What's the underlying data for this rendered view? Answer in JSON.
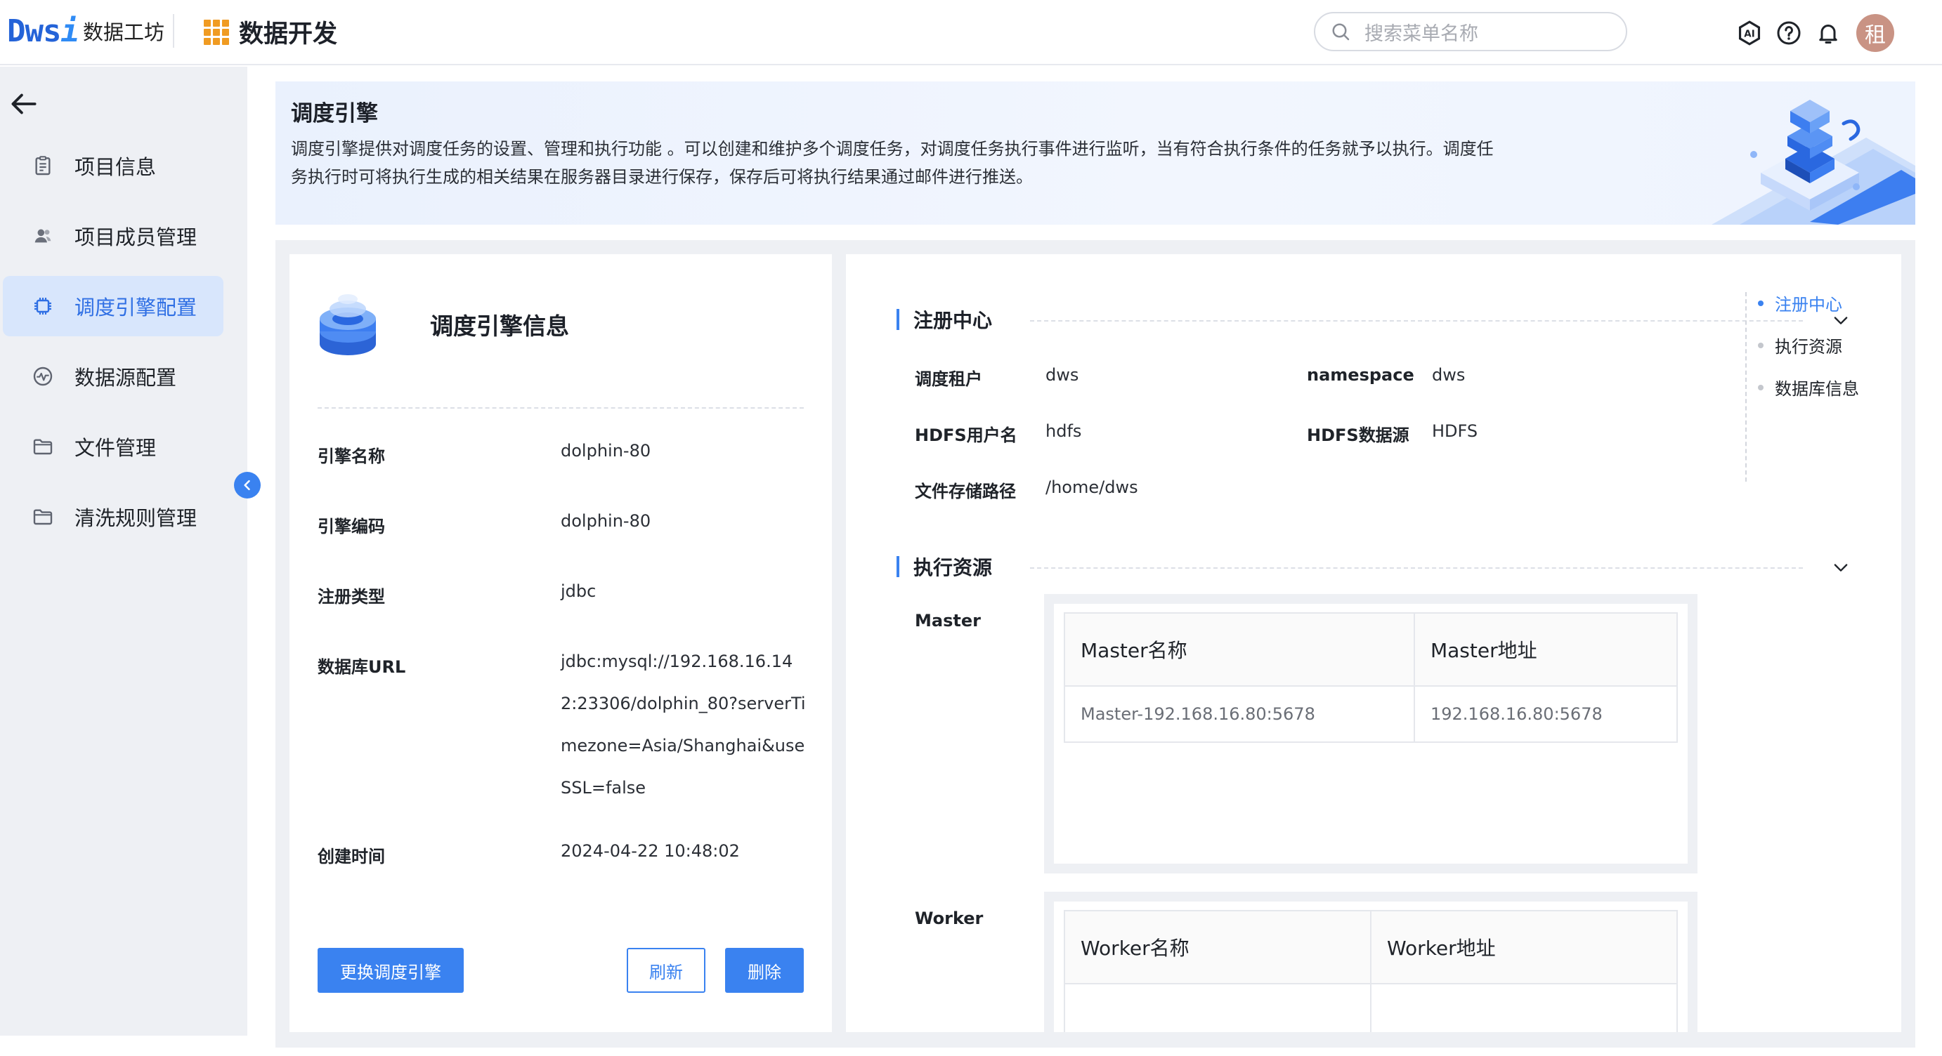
{
  "header": {
    "logo_mark": "Dws",
    "logo_mark_i": "i",
    "logo_text": "数据工坊",
    "app_title": "数据开发",
    "search_placeholder": "搜索菜单名称",
    "avatar_text": "租",
    "accent_color": "#3a82f0",
    "icons": [
      "ai-icon",
      "help-icon",
      "bell-icon"
    ]
  },
  "sidebar": {
    "items": [
      {
        "label": "项目信息",
        "icon": "clipboard-icon",
        "active": false
      },
      {
        "label": "项目成员管理",
        "icon": "users-icon",
        "active": false
      },
      {
        "label": "调度引擎配置",
        "icon": "chip-icon",
        "active": true
      },
      {
        "label": "数据源配置",
        "icon": "pulse-icon",
        "active": false
      },
      {
        "label": "文件管理",
        "icon": "folder-icon",
        "active": false
      },
      {
        "label": "清洗规则管理",
        "icon": "folder-icon",
        "active": false
      }
    ]
  },
  "banner": {
    "title": "调度引擎",
    "description": "调度引擎提供对调度任务的设置、管理和执行功能 。可以创建和维护多个调度任务，对调度任务执行事件进行监听，当有符合执行条件的任务就予以执行。调度任务执行时可将执行生成的相关结果在服务器目录进行保存，保存后可将执行结果通过邮件进行推送。"
  },
  "engine_info": {
    "title": "调度引擎信息",
    "fields": [
      {
        "label": "引擎名称",
        "value": "dolphin-80"
      },
      {
        "label": "引擎编码",
        "value": "dolphin-80"
      },
      {
        "label": "注册类型",
        "value": "jdbc"
      },
      {
        "label": "数据库URL",
        "value": "jdbc:mysql://192.168.16.142:23306/dolphin_80?serverTimezone=Asia/Shanghai&useSSL=false"
      },
      {
        "label": "创建时间",
        "value": "2024-04-22 10:48:02"
      }
    ],
    "buttons": {
      "replace": "更换调度引擎",
      "refresh": "刷新",
      "delete": "删除"
    }
  },
  "registry": {
    "title": "注册中心",
    "tenant_label": "调度租户",
    "tenant_value": "dws",
    "namespace_label": "namespace",
    "namespace_value": "dws",
    "hdfs_user_label": "HDFS用户名",
    "hdfs_user_value": "hdfs",
    "hdfs_source_label": "HDFS数据源",
    "hdfs_source_value": "HDFS",
    "path_label": "文件存储路径",
    "path_value": "/home/dws"
  },
  "resources": {
    "title": "执行资源",
    "master": {
      "label": "Master",
      "columns": [
        "Master名称",
        "Master地址"
      ],
      "rows": [
        [
          "Master-192.168.16.80:5678",
          "192.168.16.80:5678"
        ]
      ]
    },
    "worker": {
      "label": "Worker",
      "columns": [
        "Worker名称",
        "Worker地址"
      ]
    }
  },
  "anchors": [
    {
      "label": "注册中心",
      "active": true
    },
    {
      "label": "执行资源",
      "active": false
    },
    {
      "label": "数据库信息",
      "active": false
    }
  ]
}
